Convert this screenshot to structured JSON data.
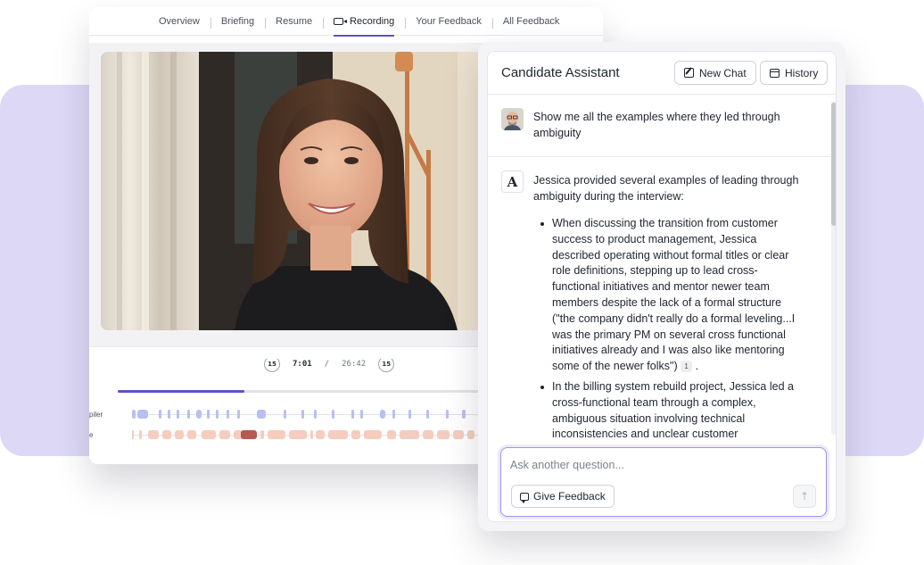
{
  "nav": {
    "tabs": [
      {
        "label": "Overview"
      },
      {
        "label": "Briefing"
      },
      {
        "label": "Resume"
      },
      {
        "label": "Recording"
      },
      {
        "label": "Your Feedback"
      },
      {
        "label": "All Feedback"
      }
    ],
    "active_tab": "Recording"
  },
  "player": {
    "skip_back": "15",
    "skip_forward": "15",
    "current_time": "7:01",
    "separator": "/",
    "total_time": "26:42",
    "progress_fraction": 0.284
  },
  "tracks": [
    {
      "label": "piler"
    },
    {
      "label": "e"
    }
  ],
  "assistant": {
    "title": "Candidate Assistant",
    "new_chat_label": "New Chat",
    "history_label": "History",
    "user_message": "Show me all the examples where they led through ambiguity",
    "ai_mark": "A",
    "ai_intro": "Jessica provided several examples of leading through ambiguity during the interview:",
    "bullets": [
      {
        "text": "When discussing the transition from customer success to product management, Jessica described operating without formal titles or clear role definitions, stepping up to lead cross-functional initiatives and mentor newer team members despite the lack of a formal structure (\"the company didn't really do a formal leveling...I was the primary PM on several cross functional initiatives already and I was also like mentoring some of the newer folks\")",
        "citation": "1",
        "tail": "."
      },
      {
        "text": "In the billing system rebuild project, Jessica led a cross-functional team through a complex, ambiguous situation involving technical inconsistencies and unclear customer",
        "citation": "",
        "tail": ""
      }
    ],
    "composer_placeholder": "Ask another question...",
    "feedback_label": "Give Feedback",
    "send_icon": "↑"
  },
  "colors": {
    "accent": "#5b52c9",
    "band": "#dcd8f6",
    "track_blue": "#b9bff0",
    "track_pink": "#f4cdbf",
    "track_dark": "#b45a52"
  }
}
